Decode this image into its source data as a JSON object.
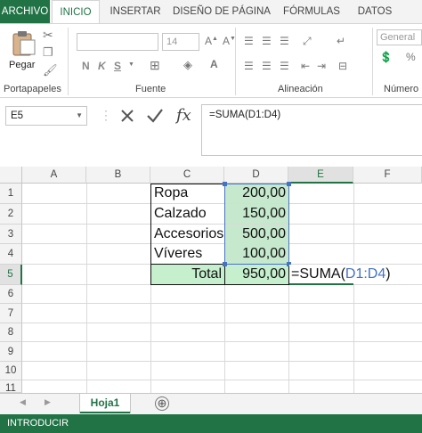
{
  "ribbon_tabs": [
    "ARCHIVO",
    "INICIO",
    "INSERTAR",
    "DISEÑO DE PÁGINA",
    "FÓRMULAS",
    "DATOS"
  ],
  "clipboard": {
    "paste_label": "Pegar",
    "group_label": "Portapapeles"
  },
  "font": {
    "size_value": "14",
    "group_label": "Fuente"
  },
  "alignment": {
    "group_label": "Alineación"
  },
  "number": {
    "format_value": "General",
    "group_label": "Número"
  },
  "formula_bar": {
    "name_box": "E5",
    "formula": "=SUMA(D1:D4)",
    "fx": "fx"
  },
  "columns": [
    "A",
    "B",
    "C",
    "D",
    "E",
    "F"
  ],
  "rows": [
    "1",
    "2",
    "3",
    "4",
    "5",
    "6",
    "7",
    "8",
    "9",
    "10",
    "11"
  ],
  "cells": {
    "c1": "Ropa",
    "d1": "200,00",
    "c2": "Calzado",
    "d2": "150,00",
    "c3": "Accesorios",
    "d3": "500,00",
    "c4": "Víveres",
    "d4": "100,00",
    "c5": "Total",
    "d5": "950,00"
  },
  "editing": {
    "prefix": "=SUMA(",
    "ref": "D1:D4",
    "suffix": ")"
  },
  "sheets": {
    "active": "Hoja1",
    "add": "⊕"
  },
  "status": {
    "mode": "INTRODUCIR"
  },
  "colors": {
    "accent": "#217346",
    "range_fill": "#c6e9ce",
    "ref_blue": "#4472c4"
  }
}
